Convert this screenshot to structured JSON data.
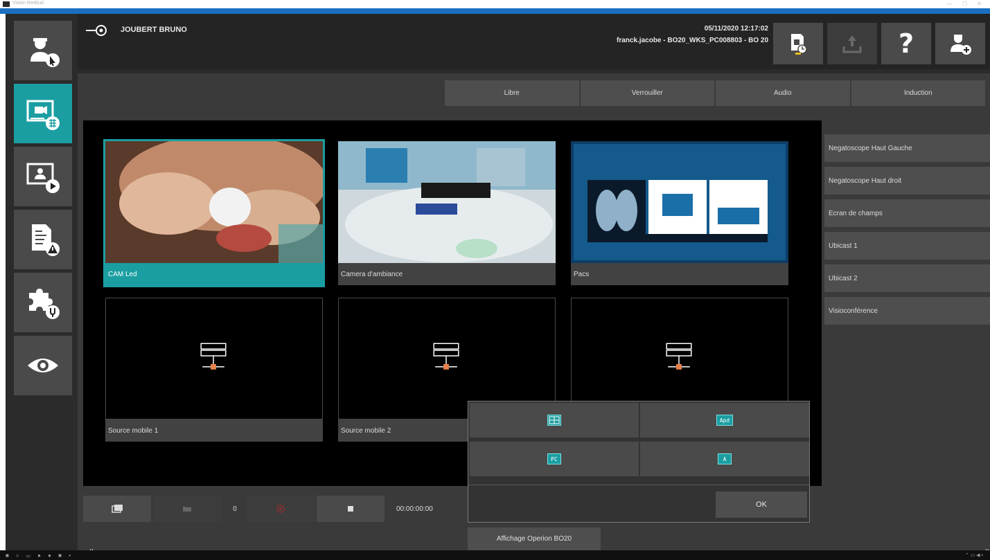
{
  "window": {
    "title": "Vision Medical",
    "controls": "— ☐ ✕",
    "accent_color": "#1b6fc2"
  },
  "header": {
    "user_name": "JOUBERT BRUNO",
    "datetime": "05/11/2020 12:17:02",
    "session": "franck.jacobe - BO20_WKS_PC008803 - BO 20",
    "help_label": "?",
    "icons": [
      "surgeon-select-icon",
      "display-icon",
      "export-icon",
      "help-icon",
      "add-user-icon"
    ]
  },
  "left_nav": {
    "items": [
      {
        "name": "surgeon-icon",
        "active": false
      },
      {
        "name": "video-routing-icon",
        "active": true
      },
      {
        "name": "video-play-icon",
        "active": false
      },
      {
        "name": "document-alert-icon",
        "active": false
      },
      {
        "name": "plugin-icon",
        "active": false
      },
      {
        "name": "eye-icon",
        "active": false
      }
    ]
  },
  "tabs": [
    "Libre",
    "Verrouiller",
    "Audio",
    "Induction"
  ],
  "sources": [
    {
      "label": "CAM Led",
      "selected": true,
      "type": "camera"
    },
    {
      "label": "Camera d'ambiance",
      "selected": false,
      "type": "room"
    },
    {
      "label": "Pacs",
      "selected": false,
      "type": "pacs"
    },
    {
      "label": "Source mobile 1",
      "selected": false,
      "type": "mobile"
    },
    {
      "label": "Source mobile 2",
      "selected": false,
      "type": "mobile"
    },
    {
      "label": "",
      "selected": false,
      "type": "mobile"
    }
  ],
  "destinations": [
    "Negatoscope Haut Gauche",
    "Negatoscope Haut droit",
    "Ecran de champs",
    "Ubicast 1",
    "Ubicast 2",
    "Visioconférence"
  ],
  "bottom_bar": {
    "count": "0",
    "timecode": "00:00:00:00"
  },
  "layout_popup": {
    "options": [
      "split-layout-icon",
      "text-layout-icon",
      "pc-layout-icon",
      "single-layout-icon"
    ],
    "option_texts": [
      "",
      "Apd",
      "PC",
      "A"
    ],
    "ok_label": "OK"
  },
  "mode_button": "Affichage Operion BO20",
  "nav_arrows": {
    "left": "⟪",
    "right": "⟫"
  },
  "colors": {
    "accent": "#1b9ea2",
    "panel": "#3a3a3a",
    "button": "#4a4a4a"
  }
}
